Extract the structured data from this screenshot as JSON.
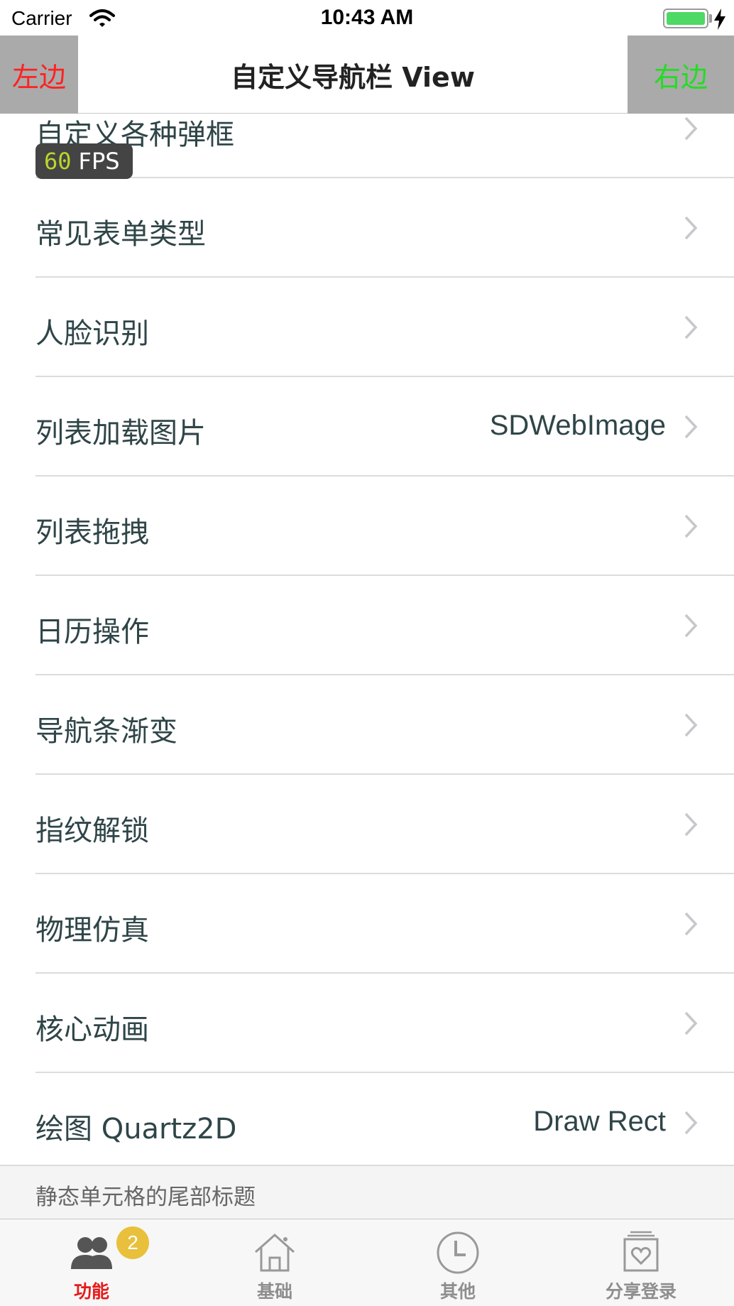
{
  "status_bar": {
    "carrier": "Carrier",
    "time": "10:43 AM",
    "battery_level": 1.0,
    "icons": [
      "wifi-icon",
      "battery-icon",
      "charging-bolt-icon"
    ]
  },
  "nav": {
    "left_label": "左边",
    "title": "自定义导航栏 View",
    "right_label": "右边",
    "left_color": "#ff2222",
    "right_color": "#22dd22",
    "button_bg": "#aaaaaa"
  },
  "fps": {
    "value": "60",
    "unit": "FPS"
  },
  "table": {
    "rows": [
      {
        "label": "自定义各种弹框",
        "detail": ""
      },
      {
        "label": "常见表单类型",
        "detail": ""
      },
      {
        "label": "人脸识别",
        "detail": ""
      },
      {
        "label": "列表加载图片",
        "detail": "SDWebImage"
      },
      {
        "label": "列表拖拽",
        "detail": ""
      },
      {
        "label": "日历操作",
        "detail": ""
      },
      {
        "label": "导航条渐变",
        "detail": ""
      },
      {
        "label": "指纹解锁",
        "detail": ""
      },
      {
        "label": "物理仿真",
        "detail": ""
      },
      {
        "label": "核心动画",
        "detail": ""
      },
      {
        "label": "绘图 Quartz2D",
        "detail": "Draw Rect"
      }
    ],
    "footer": "静态单元格的尾部标题"
  },
  "tab_bar": {
    "active_color": "#e61a1a",
    "inactive_color": "#8e8e8e",
    "tabs": [
      {
        "label": "功能",
        "icon": "people-icon",
        "badge": "2",
        "active": true
      },
      {
        "label": "基础",
        "icon": "home-icon",
        "active": false
      },
      {
        "label": "其他",
        "icon": "clock-icon",
        "active": false
      },
      {
        "label": "分享登录",
        "icon": "heart-box-icon",
        "active": false
      }
    ]
  }
}
